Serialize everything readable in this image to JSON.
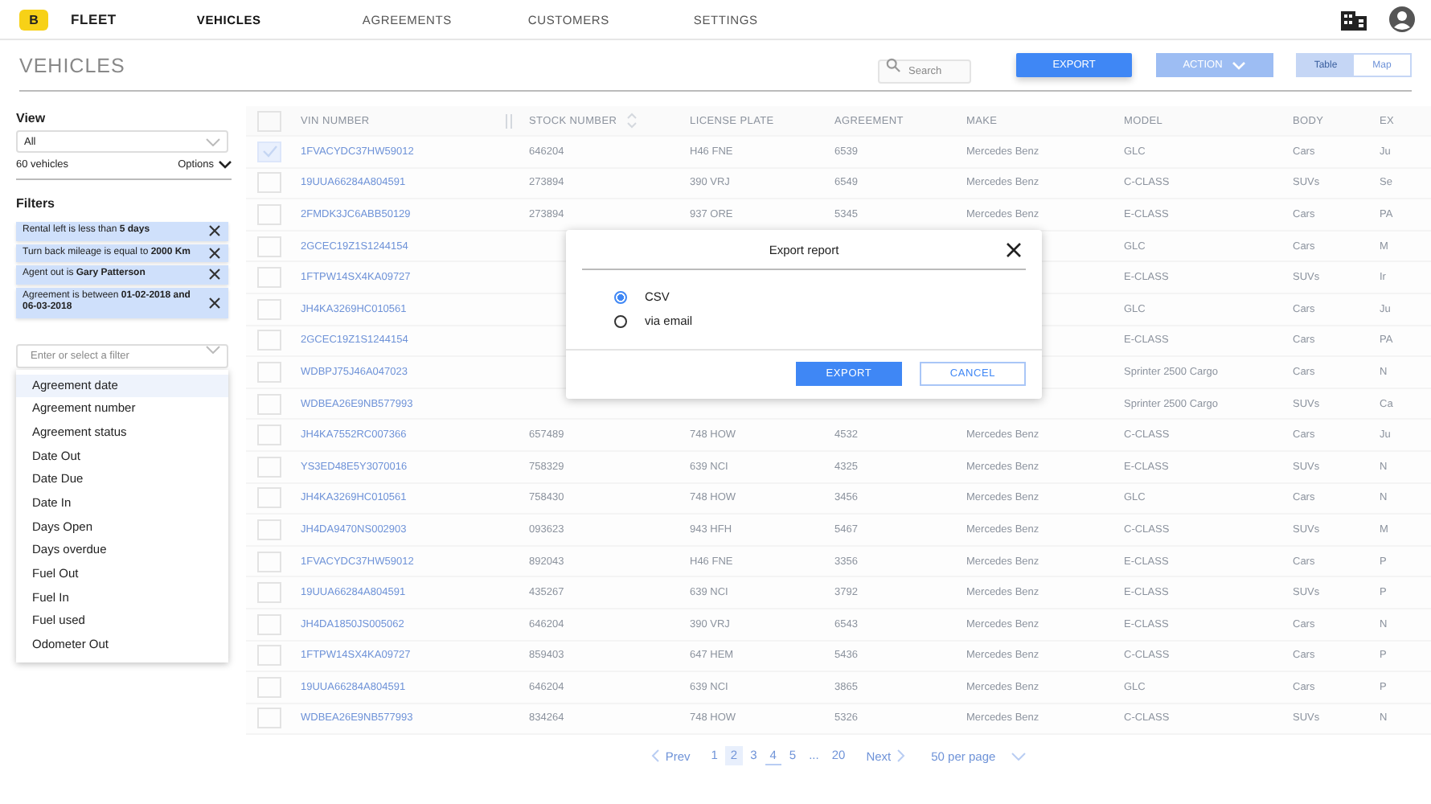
{
  "nav": {
    "logo": "B",
    "brand": "FLEET",
    "items": [
      {
        "label": "VEHICLES",
        "selected": true
      },
      {
        "label": "AGREEMENTS",
        "selected": false
      },
      {
        "label": "CUSTOMERS",
        "selected": false
      },
      {
        "label": "SETTINGS",
        "selected": false
      }
    ]
  },
  "page": {
    "title": "VEHICLES",
    "search_placeholder": "Search",
    "export_button": "EXPORT",
    "action_button": "ACTION",
    "view_toggle": [
      {
        "label": "Table",
        "selected": true
      },
      {
        "label": "Map",
        "selected": false
      }
    ]
  },
  "sidebar": {
    "view_label": "View",
    "view_select": "All",
    "count": "60 vehicles",
    "options": "Options",
    "filters_label": "Filters",
    "filters": [
      {
        "text": "Rental left is less than **5 days**"
      },
      {
        "text": "Turn back mileage is equal to **2000 Km**"
      },
      {
        "text": "Agent out is **Gary  Patterson**"
      },
      {
        "text": "Agreement is between **01-02-2018 and 06-03-2018**"
      }
    ],
    "filter_field": {
      "placeholder": "Enter or select a filter"
    },
    "filter_options": [
      {
        "label": "Agreement date",
        "selected": true
      },
      {
        "label": "Agreement number",
        "selected": false
      },
      {
        "label": "Agreement status",
        "selected": false
      },
      {
        "label": "Date Out",
        "selected": false
      },
      {
        "label": "Date Due",
        "selected": false
      },
      {
        "label": "Date In",
        "selected": false
      },
      {
        "label": "Days Open",
        "selected": false
      },
      {
        "label": "Days overdue",
        "selected": false
      },
      {
        "label": "Fuel Out",
        "selected": false
      },
      {
        "label": "Fuel In",
        "selected": false
      },
      {
        "label": "Fuel used",
        "selected": false
      },
      {
        "label": "Odometer Out",
        "selected": false
      }
    ]
  },
  "table": {
    "all_checked": false,
    "columns": [
      "VIN NUMBER",
      "STOCK NUMBER",
      "LICENSE PLATE",
      "AGREEMENT",
      "MAKE",
      "MODEL",
      "BODY",
      "EX"
    ],
    "rows": [
      {
        "checked": true,
        "cells": [
          "1FVACYDC37HW59012",
          "646204",
          "H46 FNE",
          "6539",
          "Mercedes Benz",
          "GLC",
          "Cars",
          "Ju"
        ]
      },
      {
        "checked": false,
        "cells": [
          "19UUA66284A804591",
          "273894",
          "390 VRJ",
          "6549",
          "Mercedes Benz",
          "C-CLASS",
          "SUVs",
          "Se"
        ]
      },
      {
        "checked": false,
        "cells": [
          "2FMDK3JC6ABB50129",
          "273894",
          "937 ORE",
          "5345",
          "Mercedes Benz",
          "E-CLASS",
          "Cars",
          "PA"
        ]
      },
      {
        "checked": false,
        "cells": [
          "2GCEC19Z1S1244154",
          null,
          null,
          null,
          null,
          "GLC",
          "Cars",
          "M"
        ]
      },
      {
        "checked": false,
        "cells": [
          "1FTPW14SX4KA09727",
          null,
          null,
          null,
          null,
          "E-CLASS",
          "SUVs",
          "Ir"
        ]
      },
      {
        "checked": false,
        "cells": [
          "JH4KA3269HC010561",
          null,
          null,
          null,
          null,
          "GLC",
          "Cars",
          "Ju"
        ]
      },
      {
        "checked": false,
        "cells": [
          "2GCEC19Z1S1244154",
          null,
          null,
          null,
          null,
          "E-CLASS",
          "Cars",
          "PA"
        ]
      },
      {
        "checked": false,
        "cells": [
          "WDBPJ75J46A047023",
          null,
          null,
          null,
          null,
          "Sprinter 2500 Cargo",
          "Cars",
          "N"
        ]
      },
      {
        "checked": false,
        "cells": [
          "WDBEA26E9NB577993",
          null,
          null,
          null,
          null,
          "Sprinter 2500 Cargo",
          "SUVs",
          "Ca"
        ]
      },
      {
        "checked": false,
        "cells": [
          "JH4KA7552RC007366",
          "657489",
          "748 HOW",
          "4532",
          "Mercedes Benz",
          "C-CLASS",
          "Cars",
          "Ju"
        ]
      },
      {
        "checked": false,
        "cells": [
          "YS3ED48E5Y3070016",
          "758329",
          "639 NCI",
          "4325",
          "Mercedes Benz",
          "E-CLASS",
          "SUVs",
          "N"
        ]
      },
      {
        "checked": false,
        "cells": [
          "JH4KA3269HC010561",
          "758430",
          "748 HOW",
          "3456",
          "Mercedes Benz",
          "GLC",
          "Cars",
          "N"
        ]
      },
      {
        "checked": false,
        "cells": [
          "JH4DA9470NS002903",
          "093623",
          "943 HFH",
          "5467",
          "Mercedes Benz",
          "C-CLASS",
          "SUVs",
          "M"
        ]
      },
      {
        "checked": false,
        "cells": [
          "1FVACYDC37HW59012",
          "892043",
          "H46 FNE",
          "3356",
          "Mercedes Benz",
          "E-CLASS",
          "Cars",
          "P"
        ]
      },
      {
        "checked": false,
        "cells": [
          "19UUA66284A804591",
          "435267",
          "639 NCI",
          "3792",
          "Mercedes Benz",
          "E-CLASS",
          "SUVs",
          "P"
        ]
      },
      {
        "checked": false,
        "cells": [
          "JH4DA1850JS005062",
          "646204",
          "390 VRJ",
          "6543",
          "Mercedes Benz",
          "E-CLASS",
          "Cars",
          "N"
        ]
      },
      {
        "checked": false,
        "cells": [
          "1FTPW14SX4KA09727",
          "859403",
          "647 HEM",
          "5436",
          "Mercedes Benz",
          "C-CLASS",
          "Cars",
          "P"
        ]
      },
      {
        "checked": false,
        "cells": [
          "19UUA66284A804591",
          "646204",
          "639 NCI",
          "3865",
          "Mercedes Benz",
          "GLC",
          "Cars",
          "P"
        ]
      },
      {
        "checked": false,
        "cells": [
          "WDBEA26E9NB577993",
          "834264",
          "748 HOW",
          "5326",
          "Mercedes Benz",
          "C-CLASS",
          "SUVs",
          "N"
        ]
      }
    ]
  },
  "pagination": {
    "prev": "Prev",
    "pages": [
      {
        "label": "1",
        "selected": false,
        "hovered": false
      },
      {
        "label": "2",
        "selected": true,
        "hovered": false
      },
      {
        "label": "3",
        "selected": false,
        "hovered": false
      },
      {
        "label": "4",
        "selected": false,
        "hovered": true
      },
      {
        "label": "5",
        "selected": false,
        "hovered": false
      },
      {
        "label": "...",
        "selected": false,
        "hovered": false
      },
      {
        "label": "20",
        "selected": false,
        "hovered": false
      }
    ],
    "next": "Next",
    "per_page": "50 per page"
  },
  "modal": {
    "title": "Export report",
    "options": [
      {
        "label": "CSV",
        "selected": true
      },
      {
        "label": "via email",
        "selected": false
      }
    ],
    "buttons": [
      {
        "label": "EXPORT",
        "kind": "primary"
      },
      {
        "label": "CANCEL",
        "kind": "secondary"
      }
    ]
  }
}
